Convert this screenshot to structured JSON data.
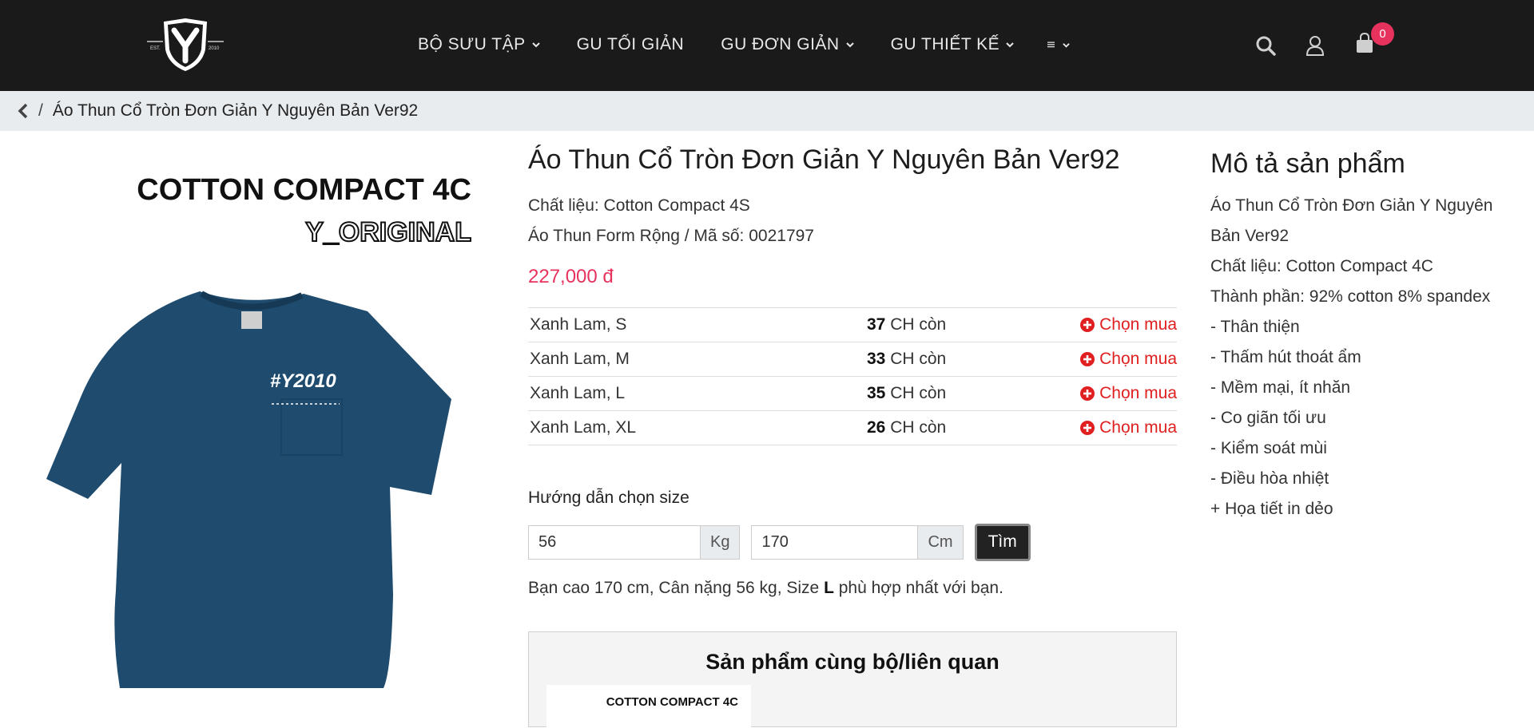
{
  "header": {
    "logo_text": "EST. Y 2010",
    "nav": [
      {
        "label": "BỘ SƯU TẬP",
        "dropdown": true
      },
      {
        "label": "GU TỐI GIẢN",
        "dropdown": false
      },
      {
        "label": "GU ĐƠN GIẢN",
        "dropdown": true
      },
      {
        "label": "GU THIẾT KẾ",
        "dropdown": true
      }
    ],
    "more_menu": "menu-icon",
    "cart_count": "0"
  },
  "breadcrumb": {
    "current": "Áo Thun Cổ Tròn Đơn Giản Y Nguyên Bản Ver92"
  },
  "product": {
    "image_text_1": "COTTON COMPACT 4C",
    "image_text_2": "Y_ORIGINAL",
    "image_text_3": "#Y2010",
    "title": "Áo Thun Cổ Tròn Đơn Giản Y Nguyên Bản Ver92",
    "material": "Chất liệu: Cotton Compact 4S",
    "form_code": "Áo Thun Form Rộng / Mã số: 0021797",
    "price": "227,000 đ",
    "variants": [
      {
        "name": "Xanh Lam, S",
        "qty": "37",
        "qty_suffix": "CH còn",
        "action": "Chọn mua"
      },
      {
        "name": "Xanh Lam, M",
        "qty": "33",
        "qty_suffix": "CH còn",
        "action": "Chọn mua"
      },
      {
        "name": "Xanh Lam, L",
        "qty": "35",
        "qty_suffix": "CH còn",
        "action": "Chọn mua"
      },
      {
        "name": "Xanh Lam, XL",
        "qty": "26",
        "qty_suffix": "CH còn",
        "action": "Chọn mua"
      }
    ]
  },
  "size_guide": {
    "heading": "Hướng dẫn chọn size",
    "weight_value": "56",
    "weight_unit": "Kg",
    "height_value": "170",
    "height_unit": "Cm",
    "button": "Tìm",
    "result_prefix": "Bạn cao 170 cm, Cân nặng 56 kg, Size ",
    "result_size": "L",
    "result_suffix": " phù hợp nhất với bạn."
  },
  "related": {
    "heading": "Sản phẩm cùng bộ/liên quan",
    "thumb_text": "COTTON COMPACT 4C"
  },
  "description": {
    "heading": "Mô tả sản phẩm",
    "lines": [
      "Áo Thun Cổ Tròn Đơn Giản Y Nguyên",
      "Bản Ver92",
      "Chất liệu: Cotton Compact 4C",
      "Thành phần: 92% cotton 8% spandex",
      "- Thân thiện",
      "- Thấm hút thoát ẩm",
      "- Mềm mại, ít nhăn",
      "- Co giãn tối ưu",
      "- Kiểm soát mùi",
      "- Điều hòa nhiệt",
      "+ Họa tiết in dẻo"
    ]
  },
  "colors": {
    "header_bg": "#1a1a1a",
    "accent": "#e8325e",
    "buy_red": "#e02020",
    "shirt": "#1f4c6e"
  }
}
